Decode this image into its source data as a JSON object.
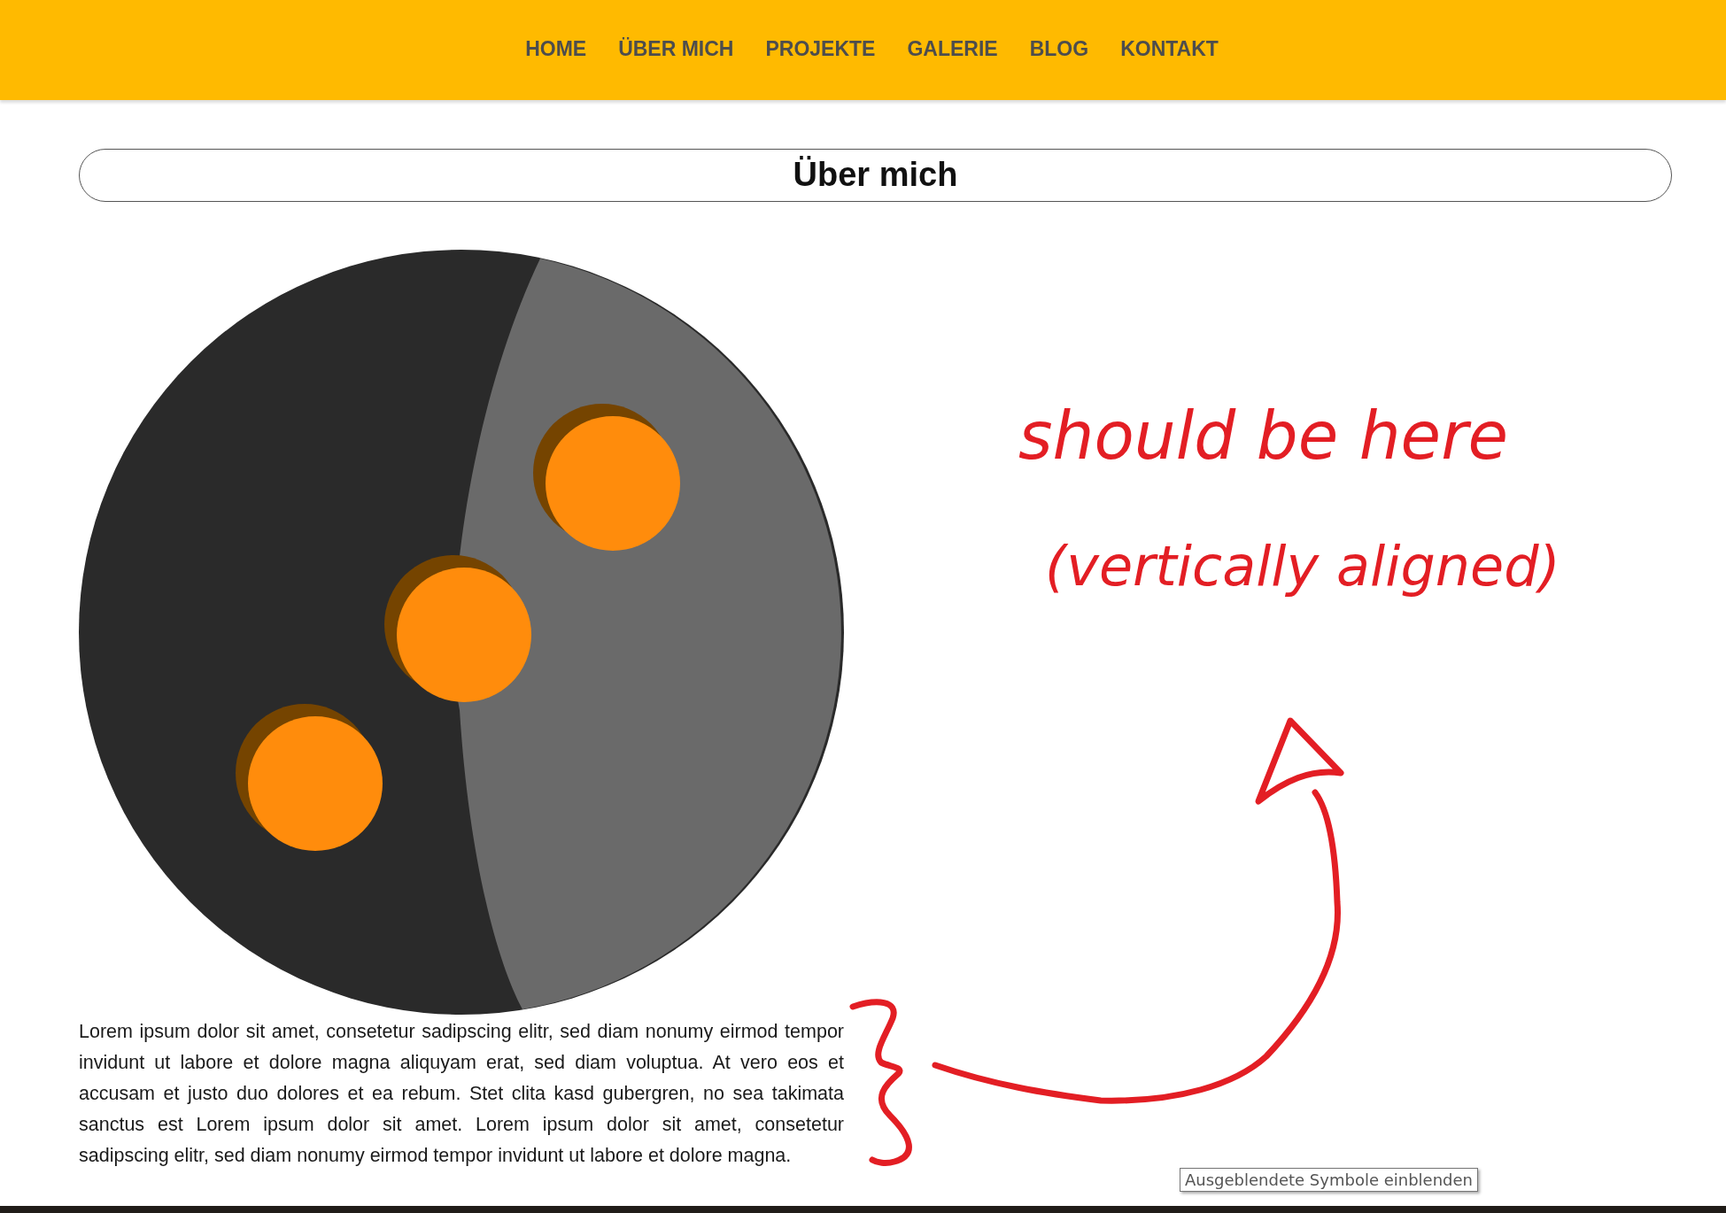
{
  "nav": {
    "items": [
      "HOME",
      "ÜBER MICH",
      "PROJEKTE",
      "GALERIE",
      "BLOG",
      "KONTAKT"
    ]
  },
  "page_title": "Über mich",
  "paragraph": "Lorem ipsum dolor sit amet, consetetur sadipscing elitr, sed diam nonumy eirmod tempor invidunt ut labore et dolore magna aliquyam erat, sed diam voluptua. At vero eos et accusam et justo duo dolores et ea rebum. Stet clita kasd gubergren, no sea takimata sanctus est Lorem ipsum dolor sit amet. Lorem ipsum dolor sit amet, consetetur sadipscing elitr, sed diam nonumy eirmod tempor invidunt ut labore et dolore magna.",
  "annotation": {
    "lines": [
      "should be here",
      "(vertically aligned)"
    ]
  },
  "tooltip": "Ausgeblendete Symbole einblenden"
}
